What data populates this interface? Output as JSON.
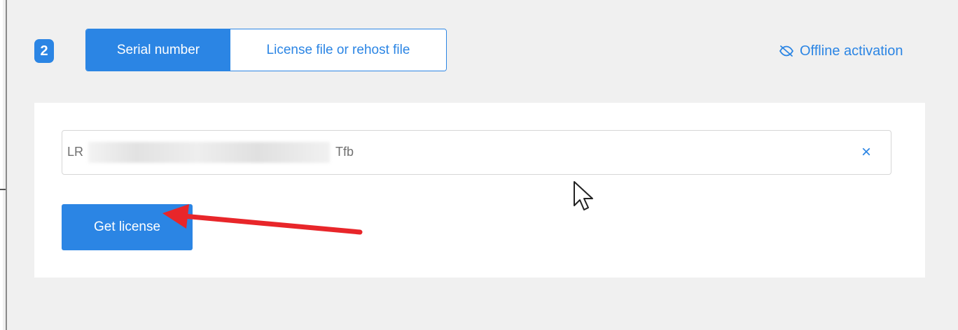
{
  "step": {
    "number": "2"
  },
  "mode_toggle": {
    "active_label": "Serial number",
    "inactive_label": "License file or rehost file"
  },
  "offline": {
    "label": "Offline activation",
    "icon": "eye-off-icon"
  },
  "serial_field": {
    "prefix": "LR",
    "suffix": "Tfb",
    "clear_label": "×",
    "clear_icon": "close-icon"
  },
  "get_license": {
    "label": "Get license"
  },
  "colors": {
    "accent": "#2b85e4",
    "page_background": "#f0f0f0",
    "card_background": "#ffffff",
    "annotation_arrow": "#e8262a"
  }
}
